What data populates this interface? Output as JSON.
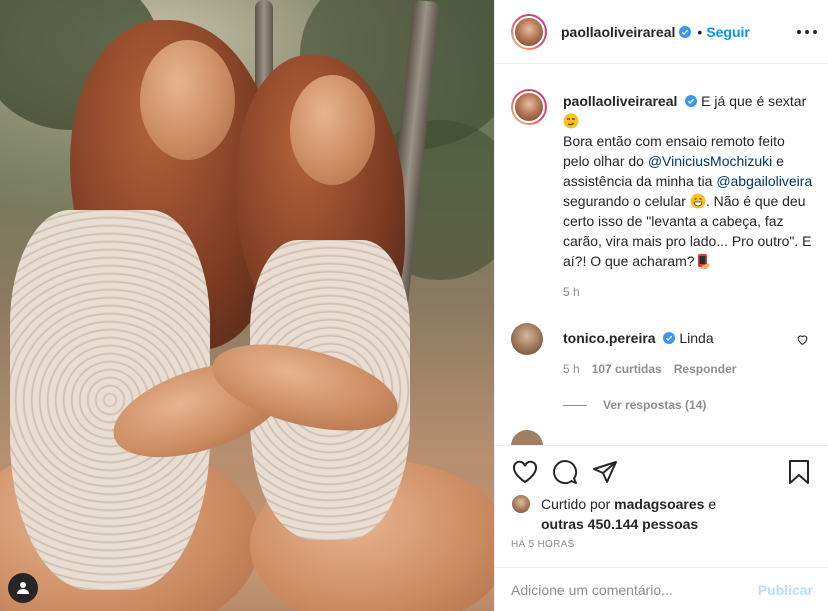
{
  "post": {
    "username": "paollaoliveirareal",
    "follow_separator": "•",
    "follow_label": "Seguir",
    "caption": {
      "username": "paollaoliveirareal",
      "part1": " E já que é sextar ",
      "part2": "Bora então com ensaio remoto feito pelo olhar do ",
      "mention1": "@ViniciusMochizuki",
      "part3": " e assistência da minha tia ",
      "mention2": "@abgailoliveira",
      "part4": " segurando o celular ",
      "part5": ". Não é que deu certo isso de \"levanta a cabeça, faz carão, vira mais pro lado... Pro outro\". E aí?! O que acharam?",
      "time": "5 h"
    },
    "comment": {
      "username": "tonico.pereira",
      "text": " Linda",
      "time": "5 h",
      "likes": "107 curtidas",
      "reply_label": "Responder",
      "view_replies": "Ver respostas (14)"
    },
    "likes": {
      "prefix": "Curtido por ",
      "user": "madagsoares",
      "middle": " e",
      "others": "outras 450.144 pessoas"
    },
    "timestamp": "HÁ 5 HORAS",
    "add_comment_placeholder": "Adicione um comentário...",
    "publish_label": "Publicar"
  },
  "icons": {
    "verified": "verified-badge-icon",
    "more": "more-options-icon",
    "like": "heart-icon",
    "comment": "comment-bubble-icon",
    "share": "paper-plane-icon",
    "save": "bookmark-icon",
    "tags": "user-tag-icon"
  },
  "colors": {
    "accent": "#0095f6",
    "verified": "#3897f0",
    "muted": "#8e8e8e",
    "mention": "#00376b",
    "publish_disabled": "#b2dffc"
  }
}
